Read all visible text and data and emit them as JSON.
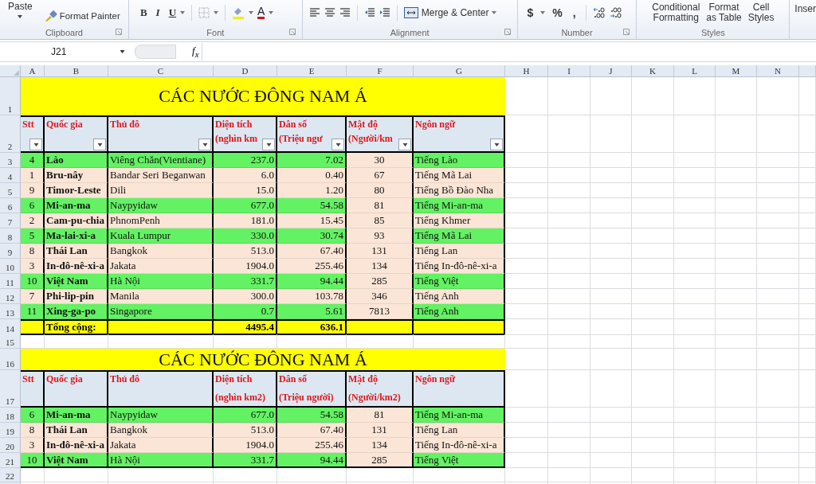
{
  "ribbon": {
    "clipboard": {
      "label": "Clipboard",
      "paste": "Paste",
      "format_painter": "Format Painter"
    },
    "font": {
      "label": "Font",
      "bold": "B",
      "italic": "I",
      "underline": "U",
      "font_color": "A"
    },
    "alignment": {
      "label": "Alignment",
      "merge": "Merge & Center"
    },
    "number": {
      "label": "Number",
      "currency": "$",
      "percent": "%",
      "comma": ","
    },
    "styles": {
      "label": "Styles",
      "buttons": [
        {
          "lines": [
            "Conditional",
            "Formatting"
          ]
        },
        {
          "lines": [
            "Format",
            "as Table"
          ]
        },
        {
          "lines": [
            "Cell",
            "Styles"
          ]
        }
      ]
    },
    "insert": "Inser"
  },
  "formula_bar": {
    "name_box": "J21",
    "fx": "f$_{x}$"
  },
  "sheet": {
    "columns": [
      "A",
      "B",
      "C",
      "D",
      "E",
      "F",
      "G",
      "H",
      "I",
      "J",
      "K",
      "L",
      "M",
      "N"
    ],
    "row_numbers": [
      "1",
      "2",
      "3",
      "4",
      "5",
      "6",
      "7",
      "8",
      "9",
      "10",
      "11",
      "12",
      "13",
      "14",
      "15",
      "16",
      "17",
      "18",
      "19",
      "20",
      "21",
      "22"
    ]
  },
  "tables": [
    {
      "title": "CÁC NƯỚC ĐÔNG NAM Á",
      "headers": [
        {
          "lines": [
            "Stt"
          ],
          "filter": true
        },
        {
          "lines": [
            "Quốc gia"
          ],
          "filter": true
        },
        {
          "lines": [
            "Thủ đô"
          ],
          "filter": true
        },
        {
          "lines": [
            "Diện tích",
            "(nghìn km"
          ],
          "filter": true
        },
        {
          "lines": [
            "Dân số",
            "(Triệu ngư"
          ],
          "filter": true
        },
        {
          "lines": [
            "Mật độ",
            "(Người/km"
          ],
          "filter": true
        },
        {
          "lines": [
            "Ngôn ngữ"
          ],
          "filter": true
        }
      ],
      "rows": [
        {
          "stt": "4",
          "country": "Lào",
          "capital": "Viêng Chăn(Vientiane)",
          "area": "237.0",
          "population": "7.02",
          "density": "30",
          "language": "Tiếng Lào",
          "highlighted": true
        },
        {
          "stt": "1",
          "country": "Bru-nây",
          "capital": "Bandar Seri Beganwan",
          "area": "6.0",
          "population": "0.40",
          "density": "67",
          "language": "Tiếng Mã Lai",
          "highlighted": false
        },
        {
          "stt": "9",
          "country": "Timor-Leste",
          "capital": "Dili",
          "area": "15.0",
          "population": "1.20",
          "density": "80",
          "language": "Tiếng Bồ Đào Nha",
          "highlighted": false
        },
        {
          "stt": "6",
          "country": "Mi-an-ma",
          "capital": "Naypyidaw",
          "area": "677.0",
          "population": "54.58",
          "density": "81",
          "language": "Tiếng Mi-an-ma",
          "highlighted": true
        },
        {
          "stt": "2",
          "country": "Cam-pu-chia",
          "capital": "PhnomPenh",
          "area": "181.0",
          "population": "15.45",
          "density": "85",
          "language": "Tiếng Khmer",
          "highlighted": false
        },
        {
          "stt": "5",
          "country": "Ma-lai-xi-a",
          "capital": "Kuala Lumpur",
          "area": "330.0",
          "population": "30.74",
          "density": "93",
          "language": "Tiếng Mã Lai",
          "highlighted": true
        },
        {
          "stt": "8",
          "country": "Thái Lan",
          "capital": "Bangkok",
          "area": "513.0",
          "population": "67.40",
          "density": "131",
          "language": "Tiếng Lan",
          "highlighted": false
        },
        {
          "stt": "3",
          "country": "In-đô-nê-xi-a",
          "capital": "Jakata",
          "area": "1904.0",
          "population": "255.46",
          "density": "134",
          "language": "Tiếng In-đô-nê-xi-a",
          "highlighted": false
        },
        {
          "stt": "10",
          "country": "Việt Nam",
          "capital": "Hà Nội",
          "area": "331.7",
          "population": "94.44",
          "density": "285",
          "language": "Tiếng Việt",
          "highlighted": true
        },
        {
          "stt": "7",
          "country": "Phi-lip-pin",
          "capital": "Manila",
          "area": "300.0",
          "population": "103.78",
          "density": "346",
          "language": "Tiếng Anh",
          "highlighted": false
        },
        {
          "stt": "11",
          "country": "Xing-ga-po",
          "capital": "Singapore",
          "area": "0.7",
          "population": "5.61",
          "density": "7813",
          "language": "Tiếng Anh",
          "highlighted": true
        }
      ],
      "total": {
        "label": "Tổng cộng:",
        "area": "4495.4",
        "population": "636.1"
      }
    },
    {
      "title": "CÁC NƯỚC ĐÔNG NAM Á",
      "headers": [
        {
          "lines": [
            "Stt"
          ],
          "filter": false
        },
        {
          "lines": [
            "Quốc gia"
          ],
          "filter": false
        },
        {
          "lines": [
            "Thủ đô"
          ],
          "filter": false
        },
        {
          "lines": [
            "Diện tích",
            "(nghìn km2)"
          ],
          "filter": false
        },
        {
          "lines": [
            "Dân số",
            "(Triệu người)"
          ],
          "filter": false
        },
        {
          "lines": [
            "Mật độ",
            "(Người/km2)"
          ],
          "filter": false
        },
        {
          "lines": [
            "Ngôn ngữ"
          ],
          "filter": false
        }
      ],
      "rows": [
        {
          "stt": "6",
          "country": "Mi-an-ma",
          "capital": "Naypyidaw",
          "area": "677.0",
          "population": "54.58",
          "density": "81",
          "language": "Tiếng Mi-an-ma",
          "highlighted": true
        },
        {
          "stt": "8",
          "country": "Thái Lan",
          "capital": "Bangkok",
          "area": "513.0",
          "population": "67.40",
          "density": "131",
          "language": "Tiếng Lan",
          "highlighted": false
        },
        {
          "stt": "3",
          "country": "In-đô-nê-xi-a",
          "capital": "Jakata",
          "area": "1904.0",
          "population": "255.46",
          "density": "134",
          "language": "Tiếng In-đô-nê-xi-a",
          "highlighted": false
        },
        {
          "stt": "10",
          "country": "Việt Nam",
          "capital": "Hà Nội",
          "area": "331.7",
          "population": "94.44",
          "density": "285",
          "language": "Tiếng Việt",
          "highlighted": true
        }
      ]
    }
  ]
}
